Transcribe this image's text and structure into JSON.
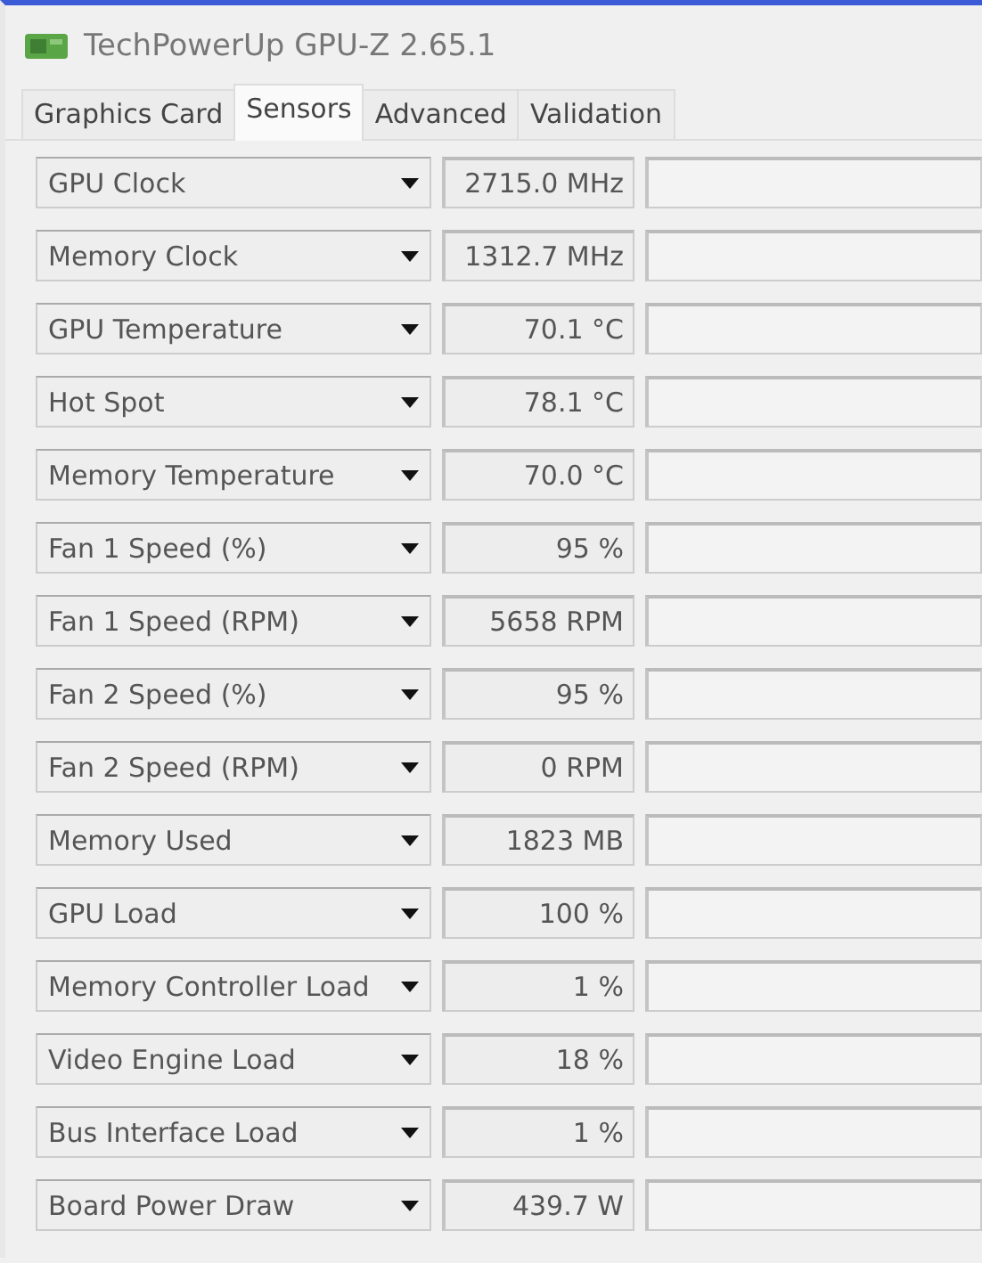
{
  "window": {
    "title": "TechPowerUp GPU-Z 2.65.1"
  },
  "tabs": [
    {
      "label": "Graphics Card",
      "selected": false
    },
    {
      "label": "Sensors",
      "selected": true
    },
    {
      "label": "Advanced",
      "selected": false
    },
    {
      "label": "Validation",
      "selected": false
    }
  ],
  "sensors": [
    {
      "name": "GPU Clock",
      "value": "2715.0 MHz"
    },
    {
      "name": "Memory Clock",
      "value": "1312.7 MHz"
    },
    {
      "name": "GPU Temperature",
      "value": "70.1 °C"
    },
    {
      "name": "Hot Spot",
      "value": "78.1 °C"
    },
    {
      "name": "Memory Temperature",
      "value": "70.0 °C"
    },
    {
      "name": "Fan 1 Speed (%)",
      "value": "95 %"
    },
    {
      "name": "Fan 1 Speed (RPM)",
      "value": "5658 RPM"
    },
    {
      "name": "Fan 2 Speed (%)",
      "value": "95 %"
    },
    {
      "name": "Fan 2 Speed (RPM)",
      "value": "0 RPM"
    },
    {
      "name": "Memory Used",
      "value": "1823 MB"
    },
    {
      "name": "GPU Load",
      "value": "100 %"
    },
    {
      "name": "Memory Controller Load",
      "value": "1 %"
    },
    {
      "name": "Video Engine Load",
      "value": "18 %"
    },
    {
      "name": "Bus Interface Load",
      "value": "1 %"
    },
    {
      "name": "Board Power Draw",
      "value": "439.7 W"
    }
  ]
}
